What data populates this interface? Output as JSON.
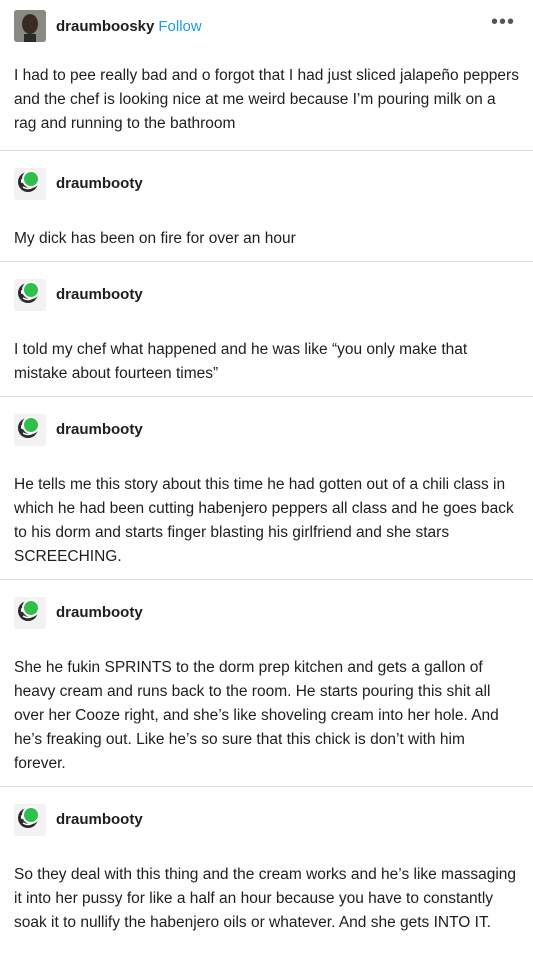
{
  "header": {
    "username": "draumboosky",
    "follow_label": "Follow",
    "more_icon": "ellipsis-icon"
  },
  "op_text": "I had to pee really bad and o forgot that I had just sliced jalapeño peppers and the chef is looking nice at me weird because I’m pouring milk on a rag and running to the bathroom",
  "reblogs": [
    {
      "username": "draumbooty",
      "text": "My dick has been on fire for over an hour"
    },
    {
      "username": "draumbooty",
      "text": "I told my chef what happened and he was like “you only make that mistake about fourteen times”"
    },
    {
      "username": "draumbooty",
      "text": "He tells me this story about this time he had gotten out of a chili class in which he had been cutting habenjero peppers all class and he goes back to his dorm and starts finger blasting his girlfriend and she stars SCREECHING."
    },
    {
      "username": "draumbooty",
      "text": "She he fukin SPRINTS to the dorm prep kitchen and gets a gallon of heavy cream and runs back to the room. He starts pouring this shit all over her Cooze right, and she’s like shoveling cream into her hole. And he’s freaking out. Like he’s so sure that this chick is don’t with him forever."
    },
    {
      "username": "draumbooty",
      "text": "So they deal with this thing and the cream works and he’s like massaging it into her pussy for like a half an hour because you have to constantly soak it to nullify the habenjero oils or whatever. And she gets INTO IT."
    }
  ],
  "colors": {
    "follow": "#1e9be6",
    "reblog_badge": "#2fbf4a",
    "divider": "#dcdcdc"
  }
}
